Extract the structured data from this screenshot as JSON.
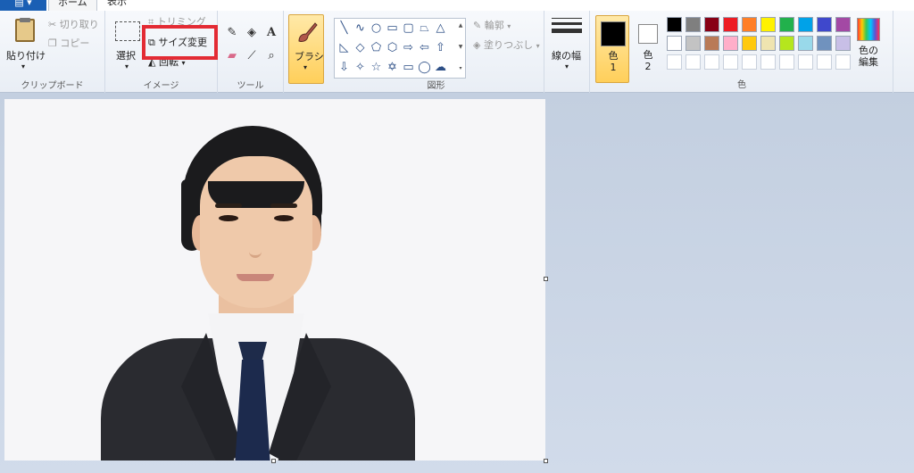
{
  "tabs": {
    "file": "▤ ▾",
    "home": "ホーム",
    "view": "表示"
  },
  "clipboard": {
    "paste": "貼り付け",
    "cut": "切り取り",
    "copy": "コピー",
    "group_label": "クリップボード"
  },
  "image": {
    "select": "選択",
    "crop": "トリミング",
    "resize": "サイズ変更",
    "rotate": "回転",
    "group_label": "イメージ"
  },
  "tools": {
    "group_label": "ツール"
  },
  "brush": {
    "label": "ブラシ"
  },
  "shapes": {
    "outline": "輪郭",
    "fill": "塗りつぶし",
    "group_label": "図形"
  },
  "size": {
    "label": "線の幅"
  },
  "colors": {
    "color1_label": "色\n1",
    "color2_label": "色\n2",
    "edit_label": "色の編集",
    "group_label": "色",
    "color1_value": "#000000",
    "color2_value": "#ffffff",
    "palette_row1": [
      "#000000",
      "#7f7f7f",
      "#880015",
      "#ed1c24",
      "#ff7f27",
      "#fff200",
      "#22b14c",
      "#00a2e8",
      "#3f48cc",
      "#a349a4"
    ],
    "palette_row2": [
      "#ffffff",
      "#c3c3c3",
      "#b97a57",
      "#ffaec9",
      "#ffc90e",
      "#efe4b0",
      "#b5e61d",
      "#99d9ea",
      "#7092be",
      "#c8bfe7"
    ],
    "palette_row3": [
      "#ffffff",
      "#ffffff",
      "#ffffff",
      "#ffffff",
      "#ffffff",
      "#ffffff",
      "#ffffff",
      "#ffffff",
      "#ffffff",
      "#ffffff"
    ]
  },
  "highlight_color": "#e32b34"
}
